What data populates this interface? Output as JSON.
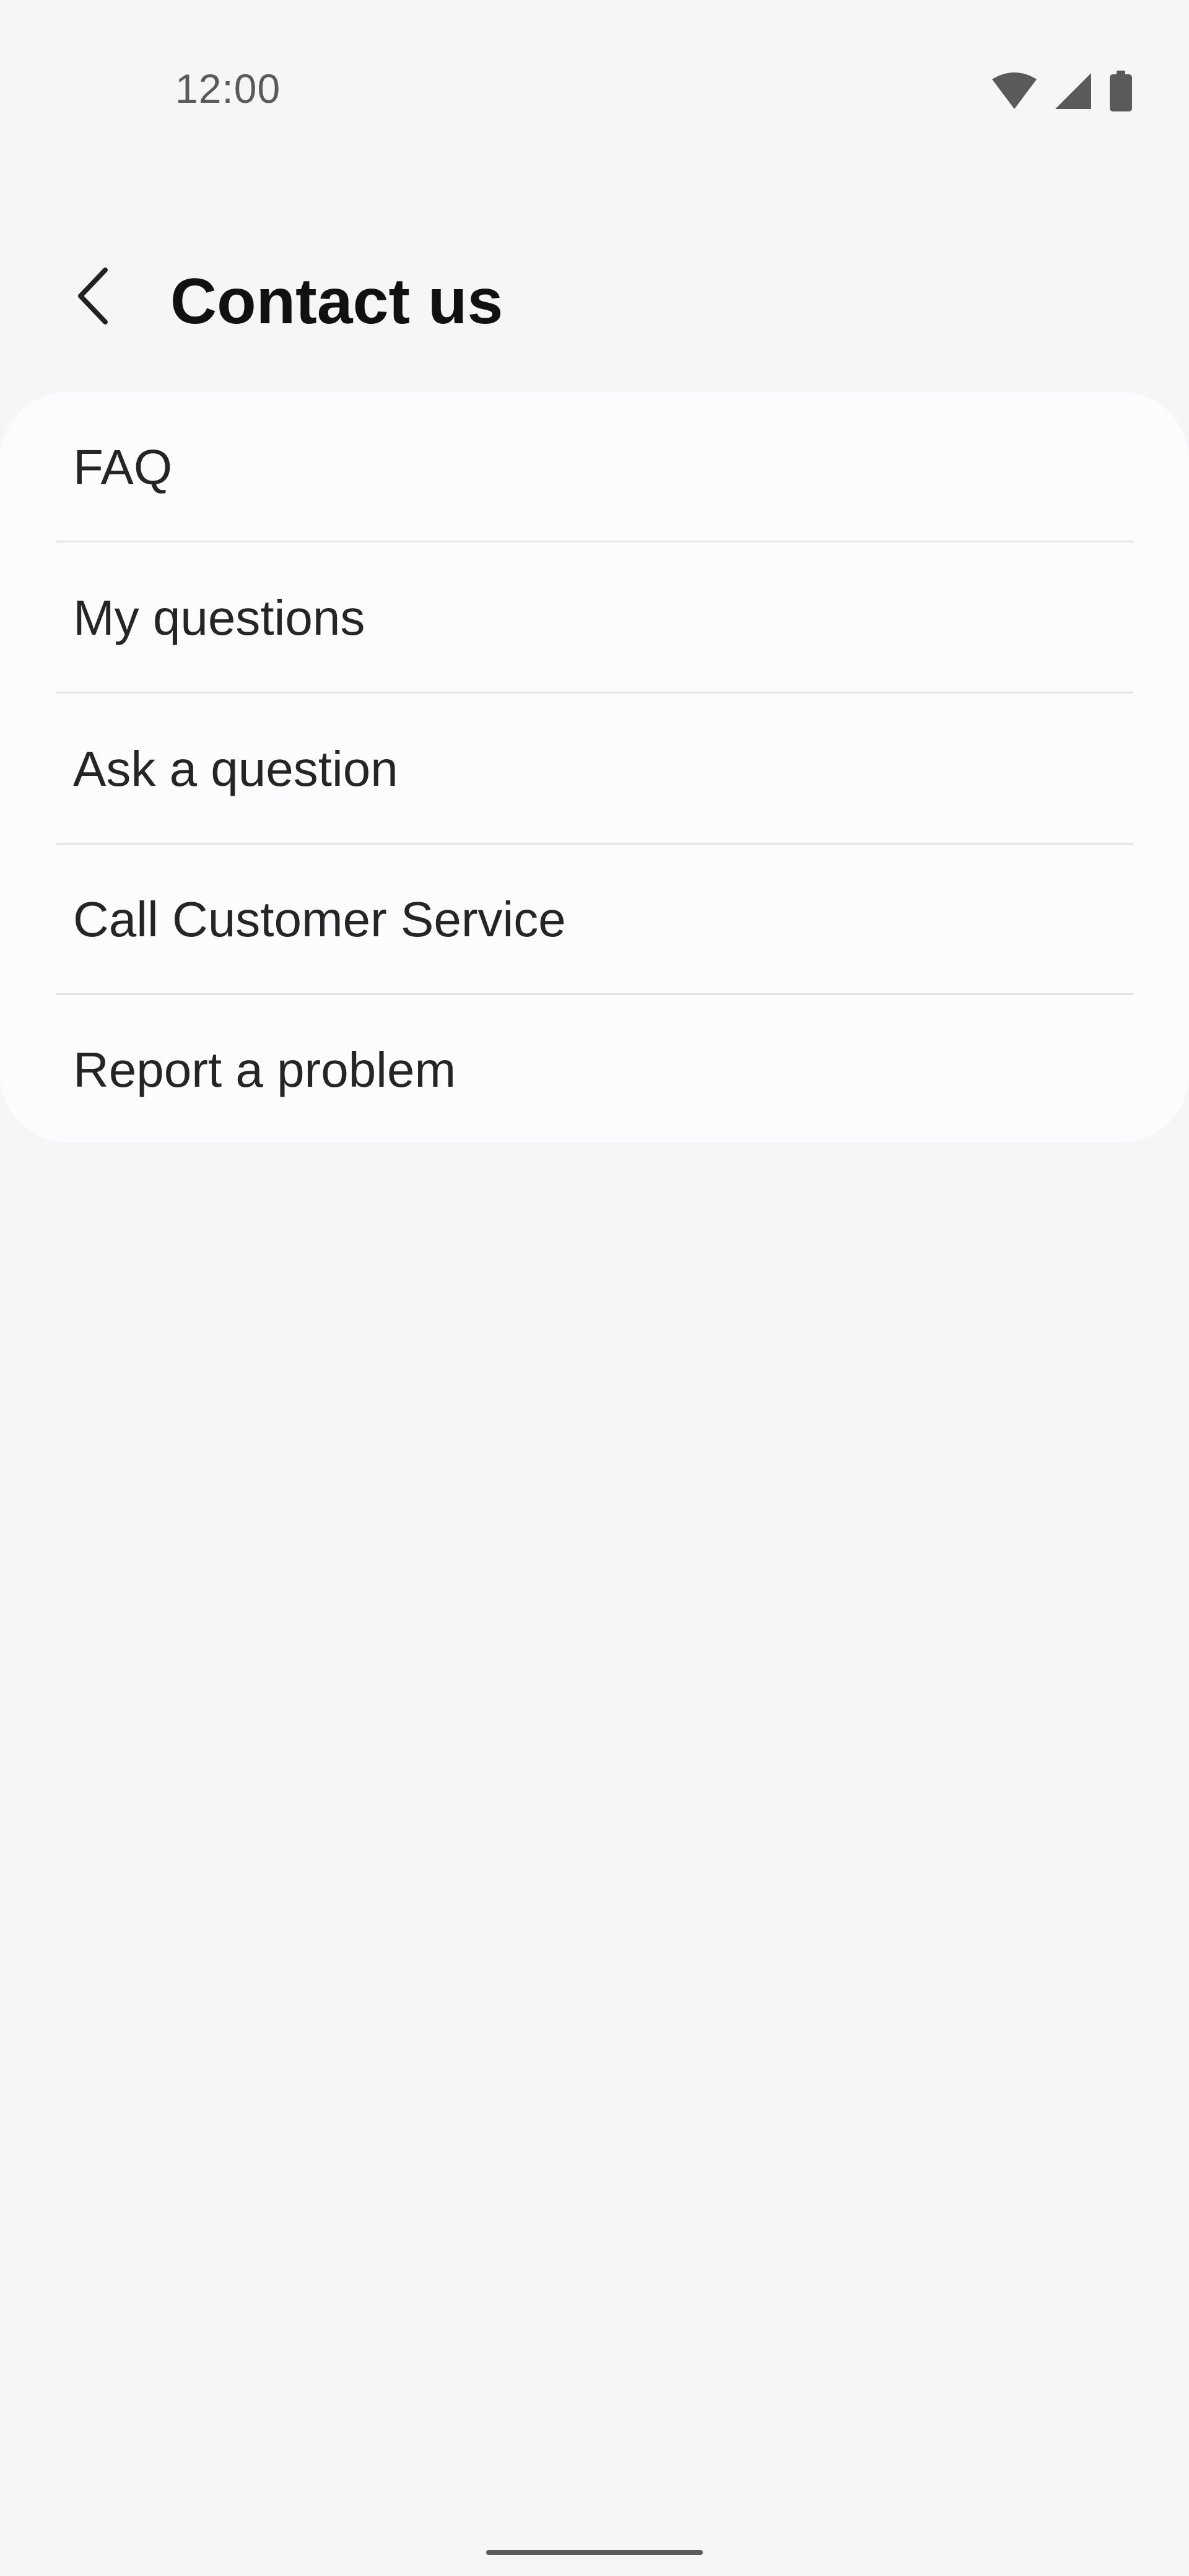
{
  "status_bar": {
    "time": "12:00",
    "icons": [
      "wifi-icon",
      "cellular-signal-icon",
      "battery-icon"
    ]
  },
  "app_bar": {
    "back_icon": "chevron-left-icon",
    "title": "Contact us"
  },
  "menu": {
    "items": [
      {
        "label": "FAQ"
      },
      {
        "label": "My questions"
      },
      {
        "label": "Ask a question"
      },
      {
        "label": "Call Customer Service"
      },
      {
        "label": "Report a problem"
      }
    ]
  },
  "colors": {
    "background": "#f6f6f6",
    "card": "#fcfcfe",
    "text_primary": "#111111",
    "text_item": "#252525",
    "divider": "#e4e4e4",
    "status_icons": "#5a5a5a"
  }
}
